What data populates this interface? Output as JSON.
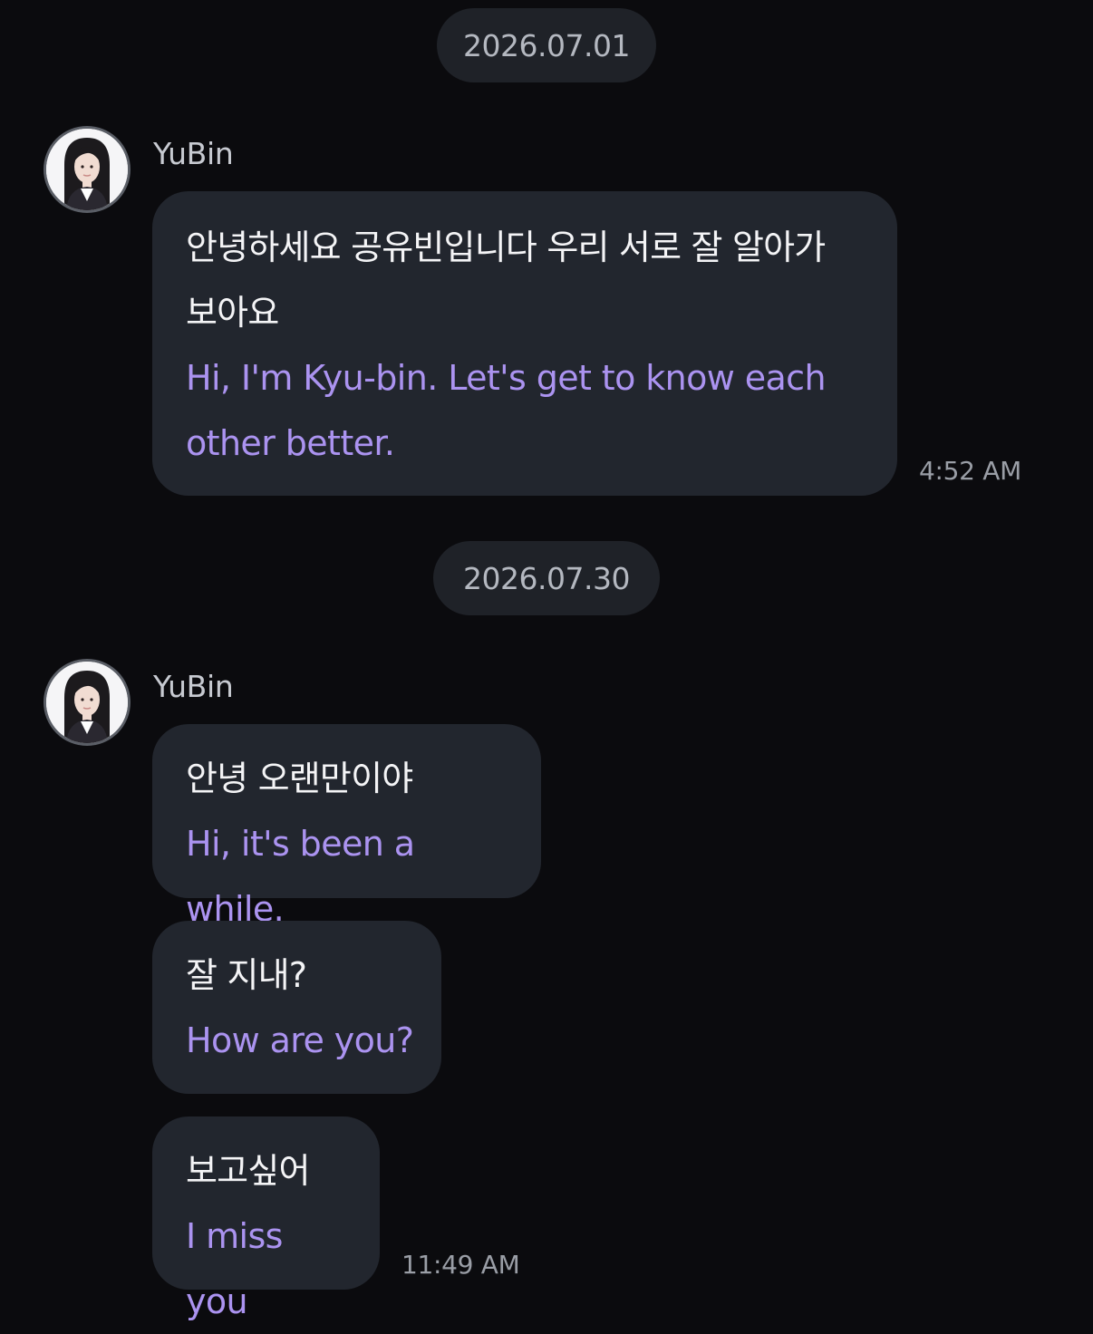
{
  "thread": {
    "sections": [
      {
        "date": "2026.07.01",
        "sender": "YuBin",
        "messages": [
          {
            "korean": "안녕하세요 공유빈입니다 우리 서로 잘 알아가 보아요",
            "english": "Hi, I'm Kyu-bin. Let's get to know each other better.",
            "time": "4:52 AM"
          }
        ]
      },
      {
        "date": "2026.07.30",
        "sender": "YuBin",
        "messages": [
          {
            "korean": "안녕 오랜만이야",
            "english": "Hi, it's been a while."
          },
          {
            "korean": "잘 지내?",
            "english": "How are you?"
          },
          {
            "korean": "보고싶어",
            "english": "I miss you",
            "time": "11:49 AM"
          }
        ]
      }
    ]
  },
  "icons": {
    "avatar": "profile-photo"
  },
  "colors": {
    "background": "#0b0b0e",
    "bubble": "#22262e",
    "date_pill": "#1f2228",
    "translation_text": "#ab93f0",
    "original_text": "#f4f4f6",
    "timestamp": "#9a9ea6"
  }
}
